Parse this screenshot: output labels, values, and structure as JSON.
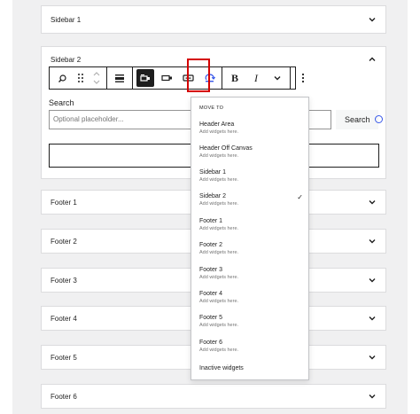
{
  "panels": [
    {
      "title": "Sidebar 1",
      "expanded": false
    },
    {
      "title": "Sidebar 2",
      "expanded": true
    },
    {
      "title": "Footer 1",
      "expanded": false
    },
    {
      "title": "Footer 2",
      "expanded": false
    },
    {
      "title": "Footer 3",
      "expanded": false
    },
    {
      "title": "Footer 4",
      "expanded": false
    },
    {
      "title": "Footer 5",
      "expanded": false
    },
    {
      "title": "Footer 6",
      "expanded": false
    }
  ],
  "toolbar": {
    "buttons": [
      {
        "name": "search-block-icon"
      },
      {
        "name": "drag-handle-icon"
      },
      {
        "name": "move-up-down-icon"
      },
      {
        "name": "align-icon"
      },
      {
        "name": "button-position-icon",
        "active": true
      },
      {
        "name": "button-inside-icon"
      },
      {
        "name": "use-button-icon"
      },
      {
        "name": "move-to-widget-area-icon"
      },
      {
        "name": "bold-icon",
        "label": "B"
      },
      {
        "name": "italic-icon",
        "label": "I"
      },
      {
        "name": "more-rich-text-icon"
      },
      {
        "name": "options-icon"
      }
    ]
  },
  "search": {
    "label": "Search",
    "placeholder": "Optional placeholder...",
    "button_label": "Search"
  },
  "move_to": {
    "heading": "MOVE TO",
    "items": [
      {
        "name": "Header Area",
        "desc": "Add widgets here.",
        "selected": false
      },
      {
        "name": "Header Off Canvas",
        "desc": "Add widgets here.",
        "selected": false
      },
      {
        "name": "Sidebar 1",
        "desc": "Add widgets here.",
        "selected": false
      },
      {
        "name": "Sidebar 2",
        "desc": "Add widgets here.",
        "selected": true
      },
      {
        "name": "Footer 1",
        "desc": "Add widgets here.",
        "selected": false
      },
      {
        "name": "Footer 2",
        "desc": "Add widgets here.",
        "selected": false
      },
      {
        "name": "Footer 3",
        "desc": "Add widgets here.",
        "selected": false
      },
      {
        "name": "Footer 4",
        "desc": "Add widgets here.",
        "selected": false
      },
      {
        "name": "Footer 5",
        "desc": "Add widgets here.",
        "selected": false
      },
      {
        "name": "Footer 6",
        "desc": "Add widgets here.",
        "selected": false
      },
      {
        "name": "Inactive widgets",
        "desc": "",
        "selected": false
      }
    ],
    "check_glyph": "✓"
  },
  "colors": {
    "highlight": "#d40000",
    "accent": "#3858e9",
    "page_bg": "#f0f0f1"
  }
}
